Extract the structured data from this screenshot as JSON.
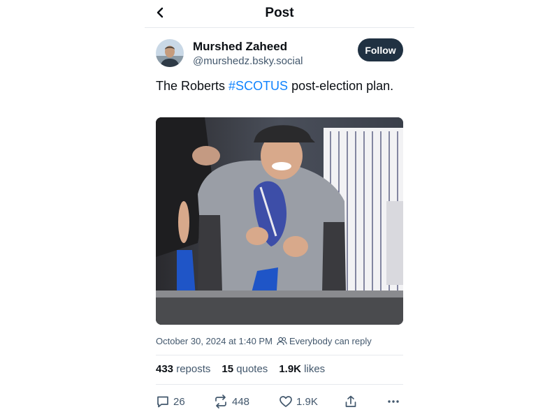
{
  "header": {
    "title": "Post",
    "back_icon": "chevron-left-icon"
  },
  "author": {
    "display_name": "Murshed Zaheed",
    "handle": "@murshedz.bsky.social",
    "follow_label": "Follow",
    "avatar_icon": "user-avatar"
  },
  "post": {
    "text_before": "The Roberts ",
    "hashtag": "#SCOTUS",
    "text_after": " post-election plan.",
    "timestamp": "October 30, 2024 at 1:40 PM",
    "reply_setting": "Everybody can reply",
    "reply_setting_icon": "people-icon"
  },
  "stats": {
    "reposts_count": "433",
    "reposts_label": "reposts",
    "quotes_count": "15",
    "quotes_label": "quotes",
    "likes_count": "1.9K",
    "likes_label": "likes"
  },
  "actions": {
    "reply_count": "26",
    "repost_count": "448",
    "like_count": "1.9K",
    "icons": [
      "reply-icon",
      "repost-icon",
      "like-icon",
      "share-icon",
      "more-icon"
    ]
  },
  "colors": {
    "text": "#0b0f14",
    "secondary": "#42576c",
    "link": "#1083fe",
    "follow_button": "#203142",
    "divider": "#e6e9ed"
  }
}
